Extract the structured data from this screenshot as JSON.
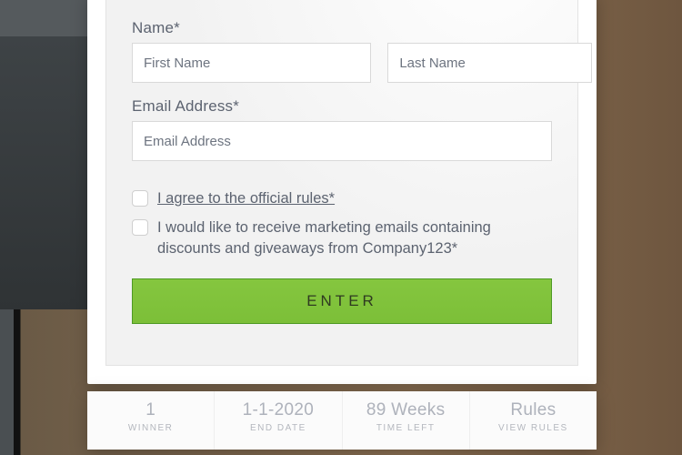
{
  "form": {
    "name_label": "Name*",
    "first_name_placeholder": "First Name",
    "last_name_placeholder": "Last Name",
    "email_label": "Email Address*",
    "email_placeholder": "Email Address",
    "rules_checkbox_text": "I agree to the official rules*",
    "marketing_checkbox_text": "I would like to receive marketing emails containing discounts and giveaways from Company123*",
    "submit_label": "ENTER"
  },
  "stats": [
    {
      "value": "1",
      "label": "WINNER"
    },
    {
      "value": "1-1-2020",
      "label": "END DATE"
    },
    {
      "value": "89 Weeks",
      "label": "TIME LEFT"
    },
    {
      "value": "Rules",
      "label": "VIEW RULES"
    }
  ]
}
